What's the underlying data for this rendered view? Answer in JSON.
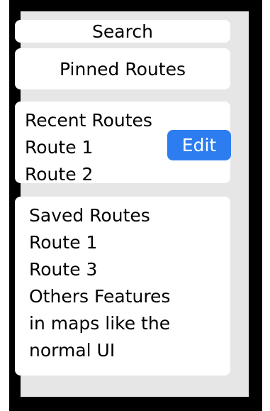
{
  "search": {
    "label": "Search"
  },
  "pinned": {
    "label": "Pinned Routes"
  },
  "recent": {
    "title": "Recent Routes",
    "items": [
      "Route 1",
      "Route 2"
    ],
    "edit_label": "Edit"
  },
  "saved": {
    "title": "Saved Routes",
    "items": [
      "Route 1",
      "Route 3"
    ],
    "notes": [
      "Others Features",
      "in maps like the",
      "normal UI"
    ]
  },
  "colors": {
    "frame": "#000000",
    "screen": "#e6e6e6",
    "card": "#ffffff",
    "accent": "#2d7df0"
  }
}
